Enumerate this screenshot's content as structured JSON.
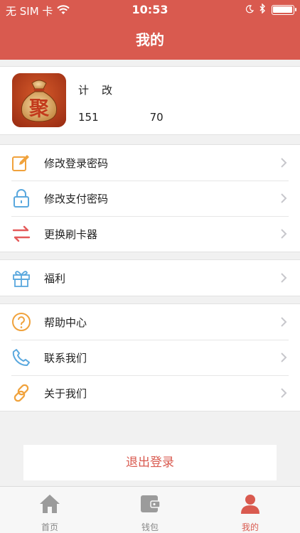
{
  "status_bar": {
    "carrier": "无 SIM 卡",
    "time": "10:53"
  },
  "header": {
    "title": "我的"
  },
  "profile": {
    "avatar_char": "聚",
    "name": "计",
    "name_tail": "改",
    "phone_prefix": "151",
    "phone_suffix": "70"
  },
  "menu": {
    "account": [
      {
        "label": "修改登录密码",
        "icon": "edit-icon"
      },
      {
        "label": "修改支付密码",
        "icon": "lock-icon"
      },
      {
        "label": "更换刷卡器",
        "icon": "swap-icon"
      }
    ],
    "benefits": [
      {
        "label": "福利",
        "icon": "gift-icon"
      }
    ],
    "support": [
      {
        "label": "帮助中心",
        "icon": "help-icon"
      },
      {
        "label": "联系我们",
        "icon": "phone-icon"
      },
      {
        "label": "关于我们",
        "icon": "link-icon"
      }
    ]
  },
  "logout_label": "退出登录",
  "tabbar": {
    "items": [
      {
        "label": "首页",
        "icon": "home-icon",
        "active": false
      },
      {
        "label": "钱包",
        "icon": "wallet-icon",
        "active": false
      },
      {
        "label": "我的",
        "icon": "user-icon",
        "active": true
      }
    ]
  },
  "colors": {
    "accent": "#d95a4f",
    "orange_icon": "#f0a23c",
    "blue_icon": "#5aa8de",
    "red_icon": "#e45a5a",
    "tab_inactive": "#9b9b9b"
  }
}
